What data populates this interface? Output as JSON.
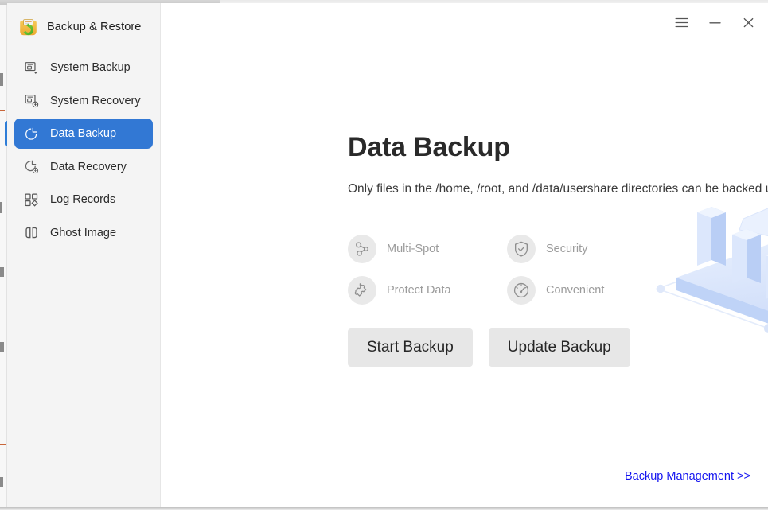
{
  "app": {
    "title": "Backup & Restore",
    "icon": "backup-restore-app-icon"
  },
  "titlebar": {
    "menu_label": "☰",
    "menu_icon": "hamburger-menu-icon",
    "minimize_icon": "minimize-icon",
    "close_icon": "close-icon"
  },
  "sidebar": {
    "items": [
      {
        "id": "system-backup",
        "label": "System Backup",
        "icon": "system-backup-icon",
        "active": false
      },
      {
        "id": "system-recovery",
        "label": "System Recovery",
        "icon": "system-recovery-icon",
        "active": false
      },
      {
        "id": "data-backup",
        "label": "Data Backup",
        "icon": "data-backup-icon",
        "active": true
      },
      {
        "id": "data-recovery",
        "label": "Data Recovery",
        "icon": "data-recovery-icon",
        "active": false
      },
      {
        "id": "log-records",
        "label": "Log Records",
        "icon": "log-records-icon",
        "active": false
      },
      {
        "id": "ghost-image",
        "label": "Ghost Image",
        "icon": "ghost-image-icon",
        "active": false
      }
    ],
    "active_color": "#3278d4",
    "background": "#f4f4f4"
  },
  "main": {
    "title": "Data Backup",
    "subtitle": "Only files in the /home, /root, and /data/usershare directories can be backed up",
    "features": [
      {
        "label": "Multi-Spot",
        "icon": "share-nodes-icon"
      },
      {
        "label": "Security",
        "icon": "shield-check-icon"
      },
      {
        "label": "Protect Data",
        "icon": "puzzle-piece-icon"
      },
      {
        "label": "Convenient",
        "icon": "gauge-icon"
      }
    ],
    "buttons": [
      {
        "id": "start-backup",
        "label": "Start Backup"
      },
      {
        "id": "update-backup",
        "label": "Update Backup"
      }
    ],
    "management_link": "Backup Management >>",
    "link_color": "#1414f0",
    "illustration": "isometric-pie-and-bar-chart-illustration"
  }
}
